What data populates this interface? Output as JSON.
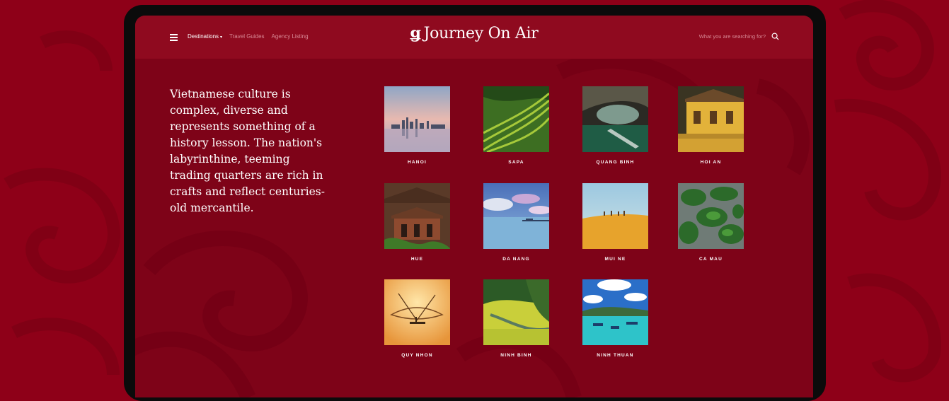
{
  "header": {
    "nav": [
      {
        "label": "Destinations",
        "active": true
      },
      {
        "label": "Travel Guides",
        "active": false
      },
      {
        "label": "Agency Listing",
        "active": false
      }
    ],
    "logo_text": "Journey On Air",
    "search_placeholder": "What you are searching for?"
  },
  "hero": {
    "text": "Vietnamese culture is complex, diverse and represents something of a history lesson. The nation's labyrinthine, teeming trading quarters are rich in crafts and reflect centuries-old mercantile."
  },
  "destinations": [
    {
      "label": "HANOI"
    },
    {
      "label": "SAPA"
    },
    {
      "label": "QUANG BINH"
    },
    {
      "label": "HOI AN"
    },
    {
      "label": "HUE"
    },
    {
      "label": "DA NANG"
    },
    {
      "label": "MUI NE"
    },
    {
      "label": "CA MAU"
    },
    {
      "label": "QUY NHON"
    },
    {
      "label": "NINH BINH"
    },
    {
      "label": "NINH THUAN"
    }
  ],
  "colors": {
    "background": "#8e0018",
    "screen": "#7e0318",
    "topbar": "#8f0a1f",
    "text": "#ffffff",
    "muted_text": "#d98a96"
  }
}
